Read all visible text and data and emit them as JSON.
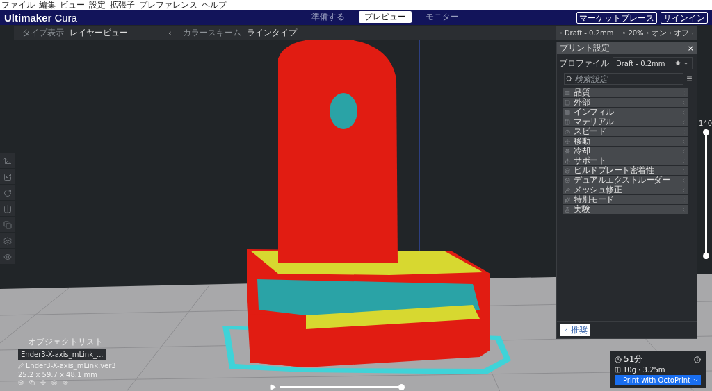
{
  "menu_bar": [
    "ファイル",
    "編集",
    "ビュー",
    "設定",
    "拡張子",
    "プレファレンス",
    "ヘルプ"
  ],
  "header": {
    "logo": "Ultimaker",
    "logo_suffix": "Cura",
    "stages": [
      {
        "label": "準備する",
        "selected": false
      },
      {
        "label": "プレビュー",
        "selected": true
      },
      {
        "label": "モニター",
        "selected": false
      }
    ],
    "buttons": [
      "マーケットプレース",
      "サインイン"
    ]
  },
  "view_bar": {
    "type_label": "タイプ表示",
    "type_value": "レイヤービュー",
    "collapse": "‹",
    "scheme_label": "カラースキーム",
    "scheme_value": "ラインタイプ"
  },
  "print_summary": {
    "profile": "Draft - 0.2mm",
    "infill": "20%",
    "support": "オン",
    "adhesion": "オフ"
  },
  "print_settings": {
    "title": "プリント設定",
    "close": "×",
    "profile_label": "プロファイル",
    "profile_value": "Draft - 0.2mm",
    "search": {
      "placeholder": "検索設定"
    },
    "categories": [
      "品質",
      "外部",
      "インフィル",
      "マテリアル",
      "スピード",
      "移動",
      "冷却",
      "サポート",
      "ビルドプレート密着性",
      "デュアルエクストルーダー",
      "メッシュ修正",
      "特別モード",
      "実験"
    ],
    "recommended_button": "推奨"
  },
  "layer_slider": {
    "reading": "140",
    "level": 1
  },
  "playback": {
    "level": 1
  },
  "object_list": {
    "title": "オブジェクトリスト",
    "selected_object": "Ender3-X-axis_mLink_...",
    "file_name": "Ender3-X-axis_mLink.ver3",
    "dimensions": "25.2 x 59.7 x 48.1 mm"
  },
  "print_job": {
    "time": "51分",
    "material": "10g · 3.25m",
    "button": "Print with OctoPrint"
  }
}
